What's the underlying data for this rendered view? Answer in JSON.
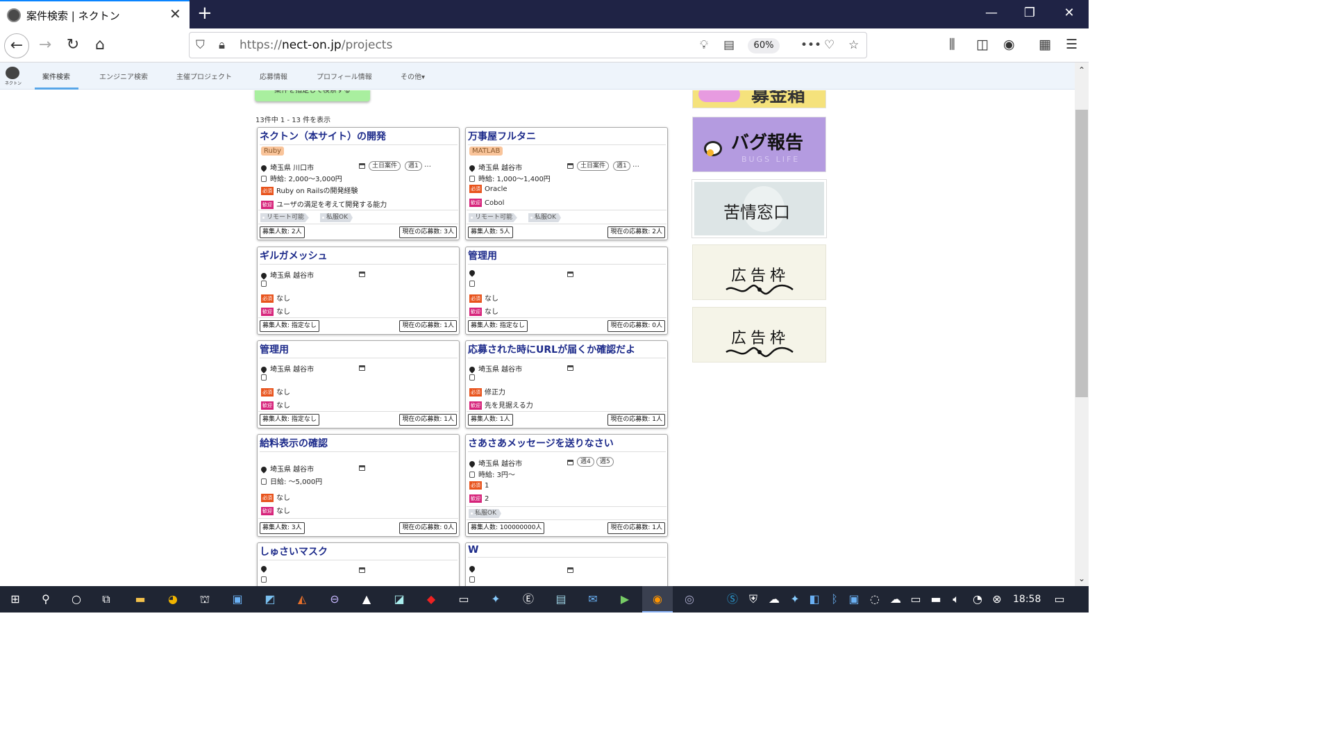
{
  "browser": {
    "tab_title": "案件検索 | ネクトン",
    "tab_close": "✕",
    "new_tab": "+",
    "url_prefix": "https://",
    "url_host": "nect-on.jp",
    "url_path": "/projects",
    "zoom": "60%"
  },
  "site_nav": {
    "logo_text": "ネクトン",
    "items": [
      {
        "label": "案件検索",
        "active": true
      },
      {
        "label": "エンジニア検索",
        "active": false
      },
      {
        "label": "主催プロジェクト",
        "active": false
      },
      {
        "label": "応募情報",
        "active": false
      },
      {
        "label": "プロフィール情報",
        "active": false
      },
      {
        "label": "その他▾",
        "active": false
      }
    ]
  },
  "search_button_label": "案件を指定して検索する",
  "result_count": "13件中 1 - 13 件を表示",
  "labels": {
    "required": "必須",
    "welcome": "歓迎"
  },
  "projects": [
    {
      "title": "ネクトン（本サイト）の開発",
      "language": "Ruby",
      "location": "埼玉県 川口市",
      "days": [
        "土日案件",
        "週1"
      ],
      "salary": "時給: 2,000〜3,000円",
      "required": "Ruby on Railsの開発経験",
      "welcome": "ユーザの満足を考えて開発する能力",
      "tags": [
        "リモート可能",
        "私服OK"
      ],
      "recruit": "募集人数: 2人",
      "applicants": "現在の応募数: 3人"
    },
    {
      "title": "万事屋フルタニ",
      "language": "MATLAB",
      "location": "埼玉県 越谷市",
      "days": [
        "土日案件",
        "週1"
      ],
      "salary": "時給: 1,000〜1,400円",
      "required": "Oracle",
      "welcome": "Cobol",
      "tags": [
        "リモート可能",
        "私服OK"
      ],
      "recruit": "募集人数: 5人",
      "applicants": "現在の応募数: 2人"
    },
    {
      "title": "ギルガメッシュ",
      "location": "埼玉県 越谷市",
      "required": "なし",
      "welcome": "なし",
      "recruit": "募集人数: 指定なし",
      "applicants": "現在の応募数: 1人"
    },
    {
      "title": "管理用",
      "location": "",
      "required": "なし",
      "welcome": "なし",
      "recruit": "募集人数: 指定なし",
      "applicants": "現在の応募数: 0人"
    },
    {
      "title": "管理用",
      "location": "埼玉県 越谷市",
      "required": "なし",
      "welcome": "なし",
      "recruit": "募集人数: 指定なし",
      "applicants": "現在の応募数: 1人"
    },
    {
      "title": "応募された時にURLが届くか確認だよ",
      "location": "埼玉県 越谷市",
      "required": "修正力",
      "welcome": "先を見据える力",
      "recruit": "募集人数: 1人",
      "applicants": "現在の応募数: 1人"
    },
    {
      "title": "給料表示の確認",
      "location": "埼玉県 越谷市",
      "salary": "日給: 〜5,000円",
      "required": "なし",
      "welcome": "なし",
      "recruit": "募集人数: 3人",
      "applicants": "現在の応募数: 0人"
    },
    {
      "title": "さあさあメッセージを送りなさい",
      "location": "埼玉県 越谷市",
      "days": [
        "週4",
        "週5"
      ],
      "salary": "時給: 3円〜",
      "required": "1",
      "welcome": "2",
      "tags": [
        "私服OK"
      ],
      "recruit": "募集人数: 100000000人",
      "applicants": "現在の応募数: 1人"
    },
    {
      "title": "しゅさいマスク"
    },
    {
      "title": "W"
    }
  ],
  "banners": {
    "recruit": "募金箱",
    "bug_report": "バグ報告",
    "bug_sub": "BUGS LIFE",
    "complaint": "苦情窓口",
    "ad1": "広告枠",
    "ad2": "広告枠"
  },
  "taskbar": {
    "time": "18:58"
  }
}
